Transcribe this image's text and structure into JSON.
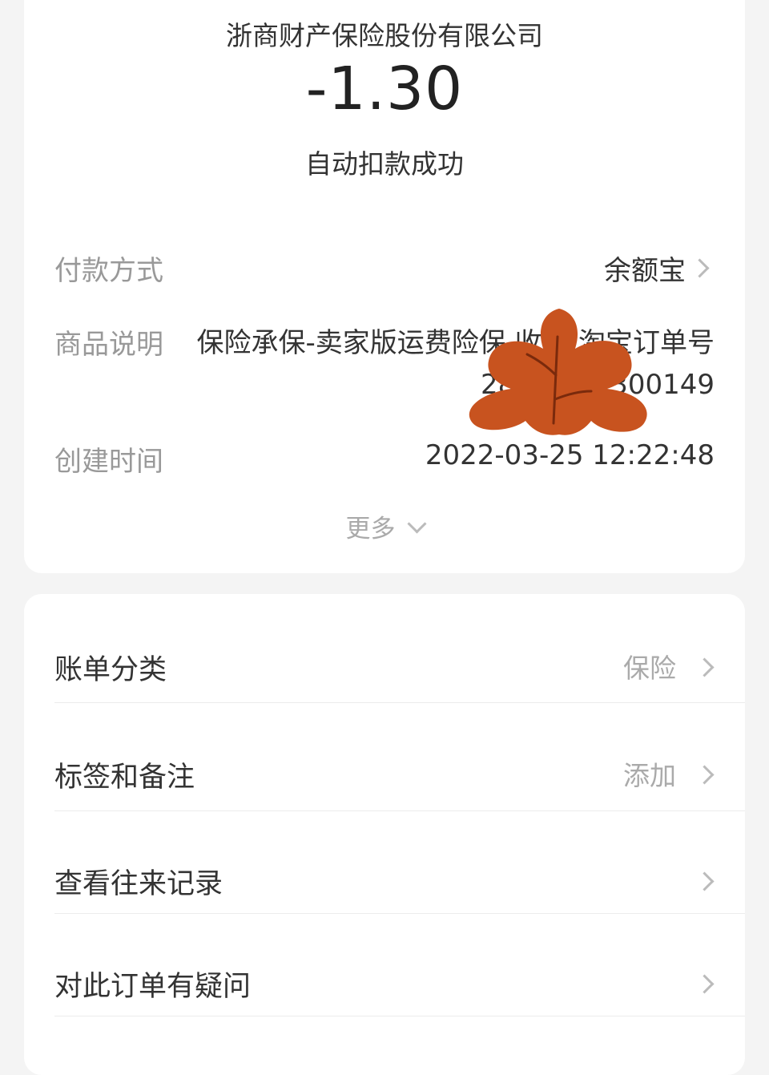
{
  "bill": {
    "merchant": "浙商财产保险股份有限公司",
    "amount": "-1.30",
    "status": "自动扣款成功"
  },
  "details": {
    "payment_method_label": "付款方式",
    "payment_method_value": "余额宝",
    "description_label": "商品说明",
    "description_value": "保险承保-卖家版运费险保 收取:淘宝订单号28422 01300149",
    "created_label": "创建时间",
    "created_value": "2022-03-25 12:22:48",
    "more_label": "更多"
  },
  "list": [
    {
      "label": "账单分类",
      "value": "保险"
    },
    {
      "label": "标签和备注",
      "value": "添加"
    },
    {
      "label": "查看往来记录",
      "value": ""
    },
    {
      "label": "对此订单有疑问",
      "value": ""
    }
  ],
  "colors": {
    "background": "#f4f4f4",
    "card": "#ffffff",
    "leaf": "#c8531f",
    "leaf_vein": "#7a2a0c"
  },
  "icons": {
    "row_chevron": "chevron-right-icon",
    "more_chevron": "chevron-down-icon",
    "sticker": "maple-leaf-icon"
  }
}
